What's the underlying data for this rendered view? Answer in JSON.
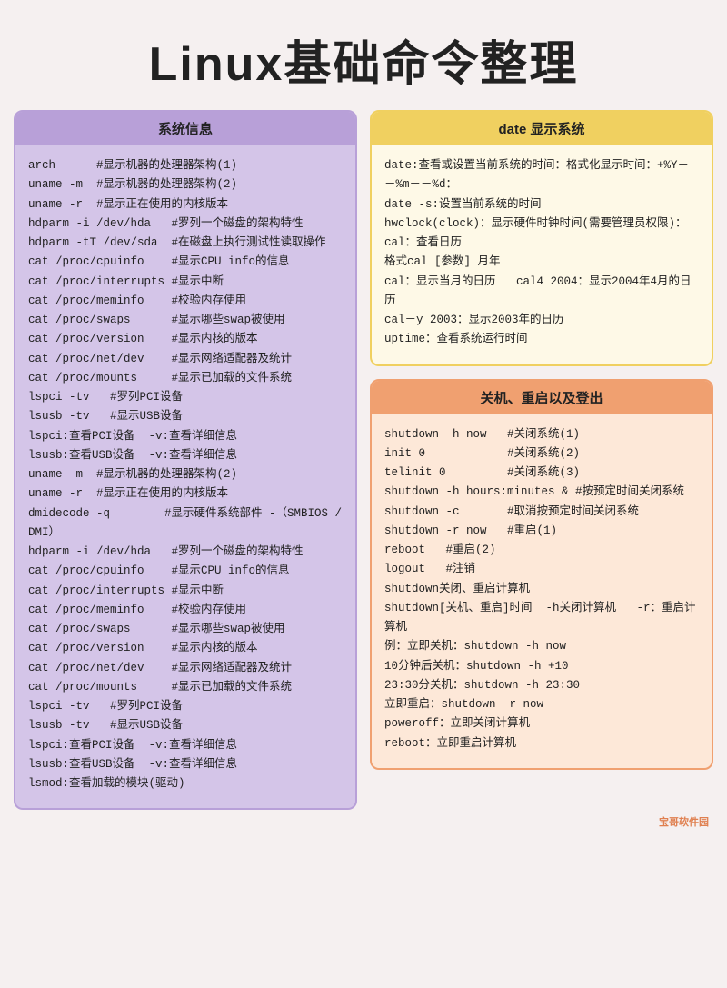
{
  "title": "Linux基础命令整理",
  "sections": {
    "system_info": {
      "header": "系统信息",
      "content": "arch      #显示机器的处理器架构(1)\nuname -m  #显示机器的处理器架构(2)\nuname -r  #显示正在使用的内核版本\nhdparm -i /dev/hda   #罗列一个磁盘的架构特性\nhdparm -tT /dev/sda  #在磁盘上执行测试性读取操作\ncat /proc/cpuinfo    #显示CPU info的信息\ncat /proc/interrupts #显示中断\ncat /proc/meminfo    #校验内存使用\ncat /proc/swaps      #显示哪些swap被使用\ncat /proc/version    #显示内核的版本\ncat /proc/net/dev    #显示网络适配器及统计\ncat /proc/mounts     #显示已加载的文件系统\nlspci -tv   #罗列PCI设备\nlsusb -tv   #显示USB设备\nlspci:查看PCI设备  -v:查看详细信息\nlsusb:查看USB设备  -v:查看详细信息\nuname -m  #显示机器的处理器架构(2)\nuname -r  #显示正在使用的内核版本\ndmidecode -q        #显示硬件系统部件 -（SMBIOS / DMI）\nhdparm -i /dev/hda   #罗列一个磁盘的架构特性\ncat /proc/cpuinfo    #显示CPU info的信息\ncat /proc/interrupts #显示中断\ncat /proc/meminfo    #校验内存使用\ncat /proc/swaps      #显示哪些swap被使用\ncat /proc/version    #显示内核的版本\ncat /proc/net/dev    #显示网络适配器及统计\ncat /proc/mounts     #显示已加载的文件系统\nlspci -tv   #罗列PCI设备\nlsusb -tv   #显示USB设备\nlspci:查看PCI设备  -v:查看详细信息\nlsusb:查看USB设备  -v:查看详细信息\nlsmod:查看加载的模块(驱动)"
    },
    "date_display": {
      "header": "date 显示系统",
      "content": "date:查看或设置当前系统的时间：格式化显示时间：+%Y－－%m－－%d：\ndate -s:设置当前系统的时间\nhwclock(clock)：显示硬件时钟时间(需要管理员权限)：\ncal：查看日历\n格式cal [参数] 月年\ncal：显示当月的日历   cal4 2004：显示2004年4月的日历\ncal－y 2003：显示2003年的日历\nuptime：查看系统运行时间"
    },
    "shutdown": {
      "header": "关机、重启以及登出",
      "content": "shutdown -h now   #关闭系统(1)\ninit 0            #关闭系统(2)\ntelinit 0         #关闭系统(3)\nshutdown -h hours:minutes & #按预定时间关闭系统\nshutdown -c       #取消按预定时间关闭系统\nshutdown -r now   #重启(1)\nreboot   #重启(2)\nlogout   #注销\nshutdown关闭、重启计算机\nshutdown[关机、重启]时间  -h关闭计算机   -r：重启计算机\n例：立即关机：shutdown -h now\n10分钟后关机：shutdown -h +10\n23:30分关机：shutdown -h 23:30\n立即重启：shutdown -r now\npoweroff：立即关闭计算机\nreboot：立即重启计算机"
    }
  },
  "watermark": "宝哥软件园"
}
